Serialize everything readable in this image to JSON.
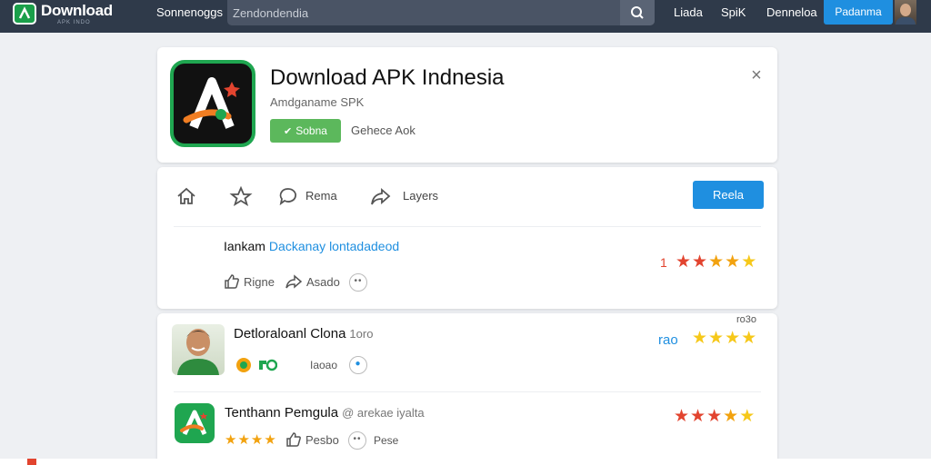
{
  "topbar": {
    "logo_title": "Download",
    "logo_sub": "APK INDO",
    "nav_left": "Sonnenoggs",
    "search_placeholder": "Zendondendia",
    "nav_right": [
      "Liada",
      "SpiK",
      "Denneloa"
    ],
    "primary_button": "Padanma"
  },
  "app": {
    "title": "Download APK Indnesia",
    "subtitle": "Amdganame SPK",
    "install_label": "Sobna",
    "secondary_link": "Gehece Aok"
  },
  "toolbar": {
    "items": [
      {
        "label": ""
      },
      {
        "label": ""
      },
      {
        "label": "Rema"
      },
      {
        "label": "Layers"
      }
    ],
    "button": "Reela"
  },
  "featured": {
    "title": "Iankam",
    "link": "Dackanay lontadadeod",
    "rating_count": "1",
    "stars": 5,
    "like_label": "Rigne",
    "share_label": "Asado"
  },
  "list": [
    {
      "name": "Detloraloanl Clona",
      "name_suffix": "1oro",
      "time": "ro3o",
      "rating_count": "rao",
      "stars": 4,
      "meta_label": "Iaoao"
    },
    {
      "name": "Tenthann Pemgula",
      "name_suffix": "@ arekae iyalta",
      "stars": 5,
      "small_stars": 4,
      "meta_label": "Pesbo",
      "meta_label_2": "Pese"
    }
  ],
  "colors": {
    "topbar": "#2f3a4a",
    "accent_blue": "#1f8fe0",
    "brand_green": "#1fa650",
    "star_red": "#e2442f",
    "star_orange": "#f2a20f",
    "star_yellow": "#f6c81a"
  }
}
